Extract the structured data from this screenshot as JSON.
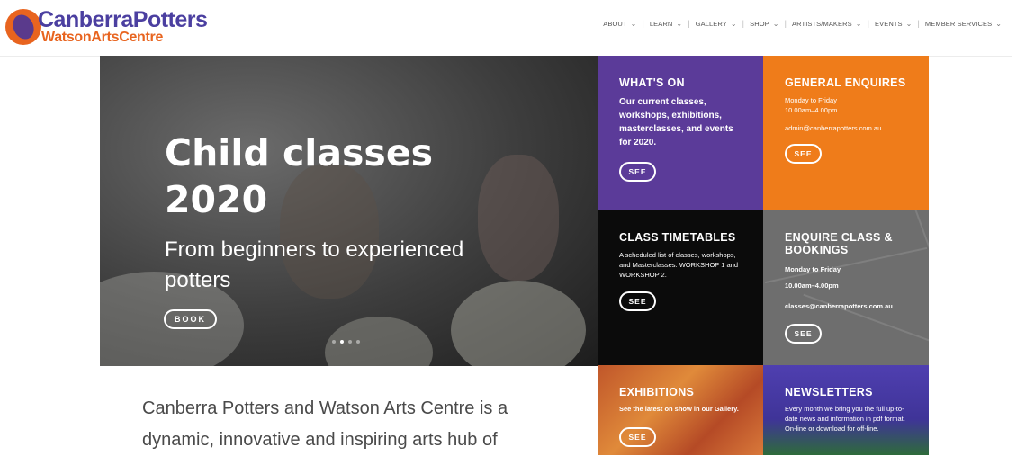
{
  "brand": {
    "line1": "CanberraPotters",
    "line2": "WatsonArtsCentre"
  },
  "nav": [
    {
      "label": "ABOUT"
    },
    {
      "label": "LEARN"
    },
    {
      "label": "GALLERY"
    },
    {
      "label": "SHOP"
    },
    {
      "label": "ARTISTS/MAKERS"
    },
    {
      "label": "EVENTS"
    },
    {
      "label": "MEMBER SERVICES"
    }
  ],
  "hero": {
    "title": "Child classes 2020",
    "subtitle": "From beginners to experienced potters",
    "button": "BOOK"
  },
  "tiles": {
    "whats_on": {
      "title": "WHAT'S ON",
      "desc": "Our current classes, workshops, exhibitions, masterclasses, and events for 2020.",
      "button": "SEE"
    },
    "general": {
      "title": "GENERAL ENQUIRES",
      "hours": "Monday to Friday 10.00am–4.00pm",
      "email": "admin@canberrapotters.com.au",
      "button": "SEE"
    },
    "timetables": {
      "title": "CLASS TIMETABLES",
      "desc": "A scheduled list of classes, workshops, and Masterclasses. WORKSHOP 1 and WORKSHOP 2.",
      "button": "SEE"
    },
    "enquire": {
      "title": "ENQUIRE CLASS & BOOKINGS",
      "days": "Monday to Friday",
      "hours": "10.00am–4.00pm",
      "email": "classes@canberrapotters.com.au",
      "button": "SEE"
    },
    "exhibitions": {
      "title": "EXHIBITIONS",
      "desc": "See the latest on show in our Gallery.",
      "button": "SEE"
    },
    "newsletters": {
      "title": "NEWSLETTERS",
      "desc": "Every month we bring you the full up-to-date news and information in pdf format. On-line or download for off-line."
    }
  },
  "intro": "Canberra Potters and Watson Arts Centre is a dynamic, innovative and inspiring arts hub of",
  "colors": {
    "purple": "#5b3b99",
    "orange": "#ef7c1a",
    "black": "#0b0b0b",
    "grey": "#6e6e6e"
  }
}
